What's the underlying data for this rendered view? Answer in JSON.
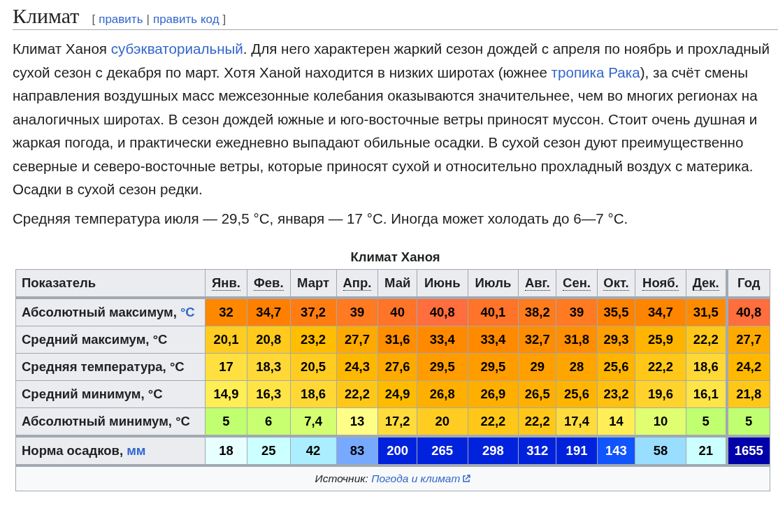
{
  "heading": {
    "title": "Климат",
    "edit_links": [
      {
        "kind": "bracket",
        "text": "["
      },
      {
        "kind": "link",
        "text": "править"
      },
      {
        "kind": "bracket",
        "text": "|"
      },
      {
        "kind": "link",
        "text": "править код"
      },
      {
        "kind": "bracket",
        "text": "]"
      }
    ]
  },
  "paragraphs": [
    [
      {
        "kind": "text",
        "text": "Климат Ханоя "
      },
      {
        "kind": "link",
        "text": "субэкваториальный"
      },
      {
        "kind": "text",
        "text": ". Для него характерен жаркий сезон дождей с апреля по ноябрь и прохладный сухой сезон с декабря по март. Хотя Ханой находится в низких широтах (южнее "
      },
      {
        "kind": "link",
        "text": "тропика Рака"
      },
      {
        "kind": "text",
        "text": "), за счёт смены направления воздушных масс межсезонные колебания оказываются значительнее, чем во многих регионах на аналогичных широтах. В сезон дождей южные и юго-восточные ветры приносят муссон. Стоит очень душная и жаркая погода, и практически ежедневно выпадают обильные осадки. В сухой сезон дуют преимущественно северные и северо-восточные ветры, которые приносят сухой и относительно прохладный воздух с материка. Осадки в сухой сезон редки."
      }
    ],
    [
      {
        "kind": "text",
        "text": "Средняя температура июля — 29,5 °C, января — 17 °C. Иногда может холодать до 6—7 °C."
      }
    ]
  ],
  "table": {
    "caption": "Климат Ханоя",
    "corner_label": "Показатель",
    "columns": [
      {
        "label": "Янв.",
        "abbr": true
      },
      {
        "label": "Фев.",
        "abbr": true
      },
      {
        "label": "Март",
        "abbr": false
      },
      {
        "label": "Апр.",
        "abbr": true
      },
      {
        "label": "Май",
        "abbr": false
      },
      {
        "label": "Июнь",
        "abbr": false
      },
      {
        "label": "Июль",
        "abbr": false
      },
      {
        "label": "Авг.",
        "abbr": true
      },
      {
        "label": "Сен.",
        "abbr": true
      },
      {
        "label": "Окт.",
        "abbr": true
      },
      {
        "label": "Нояб.",
        "abbr": true
      },
      {
        "label": "Дек.",
        "abbr": true
      },
      {
        "label": "Год",
        "abbr": false
      }
    ],
    "rows": [
      {
        "label": "Абсолютный максимум, ",
        "unit": "°C",
        "unit_link": true,
        "cells": [
          {
            "v": "32",
            "color": "#ff8800"
          },
          {
            "v": "34,7",
            "color": "#ff8000"
          },
          {
            "v": "37,2",
            "color": "#ff7d10"
          },
          {
            "v": "39",
            "color": "#ff7a20"
          },
          {
            "v": "40",
            "color": "#ff7428"
          },
          {
            "v": "40,8",
            "color": "#ff6e3c"
          },
          {
            "v": "40,1",
            "color": "#ff7428"
          },
          {
            "v": "38,2",
            "color": "#ff7c1c"
          },
          {
            "v": "39",
            "color": "#ff7a20"
          },
          {
            "v": "35,5",
            "color": "#ff8200"
          },
          {
            "v": "34,7",
            "color": "#ff8500"
          },
          {
            "v": "31,5",
            "color": "#ff8c00"
          },
          {
            "v": "40,8",
            "color": "#ff6e3c"
          }
        ]
      },
      {
        "label": "Средний максимум, ",
        "unit": "°C",
        "unit_link": false,
        "cells": [
          {
            "v": "20,1",
            "color": "#ffcc22"
          },
          {
            "v": "20,8",
            "color": "#ffca1c"
          },
          {
            "v": "23,2",
            "color": "#ffbe00"
          },
          {
            "v": "27,7",
            "color": "#ffaa00"
          },
          {
            "v": "31,6",
            "color": "#ff8e00"
          },
          {
            "v": "33,4",
            "color": "#ff8a00"
          },
          {
            "v": "33,4",
            "color": "#ff8a00"
          },
          {
            "v": "32,7",
            "color": "#ff8d00"
          },
          {
            "v": "31,8",
            "color": "#ff8e00"
          },
          {
            "v": "29,3",
            "color": "#ffa000"
          },
          {
            "v": "25,9",
            "color": "#ffb400"
          },
          {
            "v": "22,2",
            "color": "#ffc818"
          },
          {
            "v": "27,7",
            "color": "#ffaa00"
          }
        ]
      },
      {
        "label": "Средняя температура, ",
        "unit": "°C",
        "unit_link": false,
        "cells": [
          {
            "v": "17",
            "color": "#ffe040"
          },
          {
            "v": "18,3",
            "color": "#ffd838"
          },
          {
            "v": "20,5",
            "color": "#ffcc22"
          },
          {
            "v": "24,3",
            "color": "#ffb800"
          },
          {
            "v": "27,6",
            "color": "#ffaa00"
          },
          {
            "v": "29,5",
            "color": "#ff9c00"
          },
          {
            "v": "29,5",
            "color": "#ff9c00"
          },
          {
            "v": "29",
            "color": "#ffa000"
          },
          {
            "v": "28",
            "color": "#ffa500"
          },
          {
            "v": "25,6",
            "color": "#ffb500"
          },
          {
            "v": "22,2",
            "color": "#ffc818"
          },
          {
            "v": "18,6",
            "color": "#ffd836"
          },
          {
            "v": "24,2",
            "color": "#ffb800"
          }
        ]
      },
      {
        "label": "Средний минимум, ",
        "unit": "°C",
        "unit_link": false,
        "cells": [
          {
            "v": "14,9",
            "color": "#ffee55"
          },
          {
            "v": "16,3",
            "color": "#ffe448"
          },
          {
            "v": "18,6",
            "color": "#ffd836"
          },
          {
            "v": "22,2",
            "color": "#ffc818"
          },
          {
            "v": "24,9",
            "color": "#ffbb00"
          },
          {
            "v": "26,8",
            "color": "#ffaf00"
          },
          {
            "v": "26,9",
            "color": "#ffaf00"
          },
          {
            "v": "26,5",
            "color": "#ffb000"
          },
          {
            "v": "25,6",
            "color": "#ffb500"
          },
          {
            "v": "23,2",
            "color": "#ffc010"
          },
          {
            "v": "19,6",
            "color": "#ffd22c"
          },
          {
            "v": "16,1",
            "color": "#ffe448"
          },
          {
            "v": "21,8",
            "color": "#ffc818"
          }
        ]
      },
      {
        "label": "Абсолютный минимум, ",
        "unit": "°C",
        "unit_link": false,
        "cells": [
          {
            "v": "5",
            "color": "#c0ff70"
          },
          {
            "v": "6",
            "color": "#c8ff70"
          },
          {
            "v": "7,4",
            "color": "#d4ff70"
          },
          {
            "v": "13",
            "color": "#ffff88"
          },
          {
            "v": "17,2",
            "color": "#ffdc3c"
          },
          {
            "v": "20",
            "color": "#ffcc22"
          },
          {
            "v": "22,2",
            "color": "#ffc818"
          },
          {
            "v": "22,2",
            "color": "#ffc818"
          },
          {
            "v": "17,4",
            "color": "#ffdc3c"
          },
          {
            "v": "14",
            "color": "#ffee55"
          },
          {
            "v": "10",
            "color": "#e0ff70"
          },
          {
            "v": "5",
            "color": "#c0ff70"
          },
          {
            "v": "5",
            "color": "#c0ff70"
          }
        ]
      },
      {
        "label": "Норма осадков, ",
        "unit": "мм",
        "unit_link": true,
        "cells": [
          {
            "v": "18",
            "color": "#e8ffff"
          },
          {
            "v": "25",
            "color": "#ccffff"
          },
          {
            "v": "42",
            "color": "#aaeeff"
          },
          {
            "v": "83",
            "color": "#77aaff"
          },
          {
            "v": "200",
            "color": "#0022dd"
          },
          {
            "v": "265",
            "color": "#0022dd"
          },
          {
            "v": "298",
            "color": "#0022dd"
          },
          {
            "v": "312",
            "color": "#0022dd"
          },
          {
            "v": "191",
            "color": "#0022dd"
          },
          {
            "v": "143",
            "color": "#1155ff"
          },
          {
            "v": "58",
            "color": "#99ddff"
          },
          {
            "v": "21",
            "color": "#ccffff"
          },
          {
            "v": "1655",
            "color": "#0000aa"
          }
        ]
      }
    ],
    "source": {
      "label": "Источник: ",
      "link": "Погода и климат"
    }
  }
}
